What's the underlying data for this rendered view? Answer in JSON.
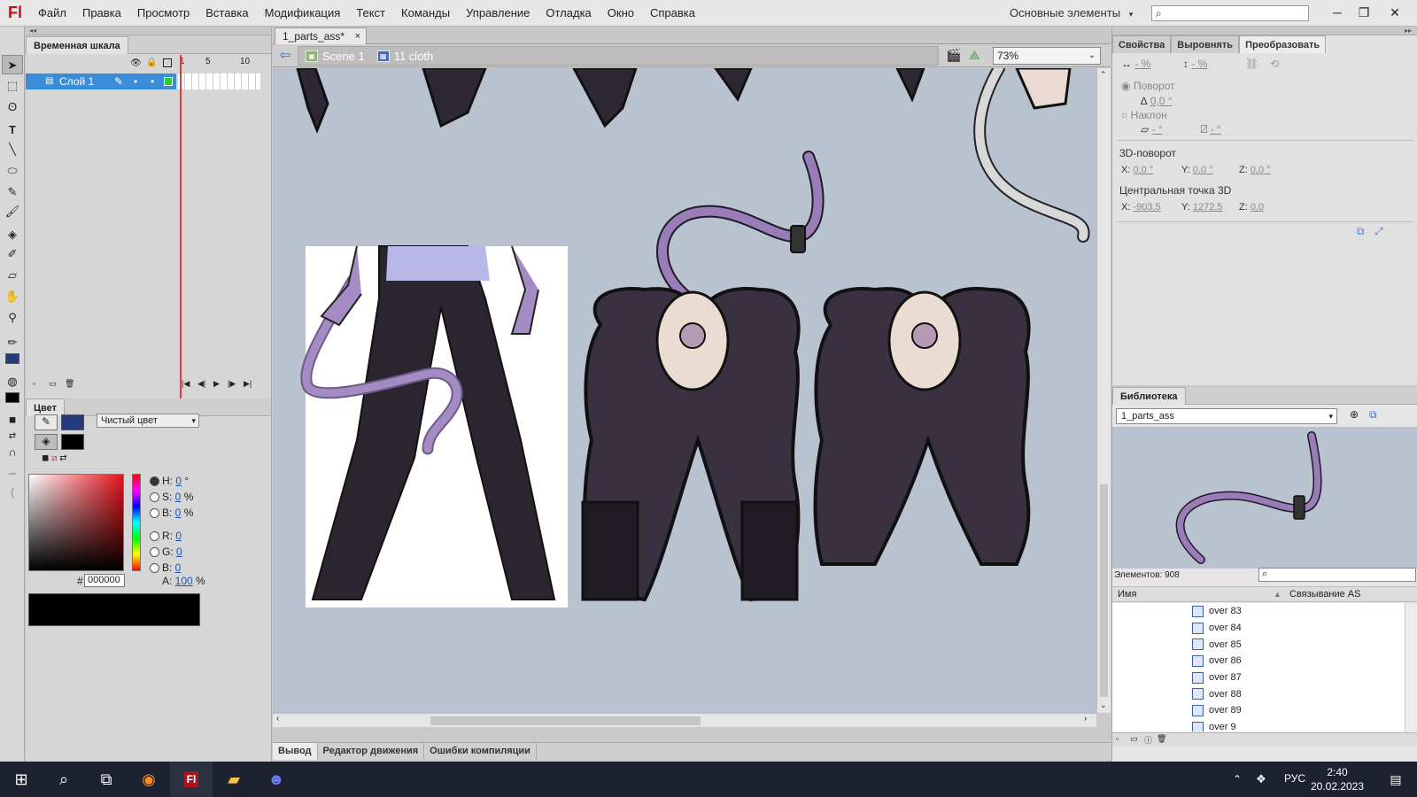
{
  "app": {
    "logo": "Fl",
    "menu": [
      "Файл",
      "Правка",
      "Просмотр",
      "Вставка",
      "Модификация",
      "Текст",
      "Команды",
      "Управление",
      "Отладка",
      "Окно",
      "Справка"
    ],
    "workspace": "Основные элементы",
    "window_controls": [
      "─",
      "❐",
      "✕"
    ]
  },
  "timeline": {
    "tab": "Временная шкала",
    "layer_name": "Слой 1",
    "frame_numbers": [
      "1",
      "5",
      "10"
    ]
  },
  "color_panel": {
    "tab": "Цвет",
    "color_type": "Чистый цвет",
    "H": "0",
    "H_unit": "°",
    "S": "0",
    "S_unit": "%",
    "B": "0",
    "B_unit": "%",
    "R": "0",
    "G": "0",
    "Bl": "0",
    "hex_prefix": "#",
    "hex": "000000",
    "alpha": "100",
    "alpha_unit": "%",
    "stroke_color": "#243a7a",
    "fill_color": "#000000"
  },
  "document": {
    "tab": "1_parts_ass*",
    "tab_close": "×",
    "breadcrumbs": [
      "Scene 1",
      "11 cloth"
    ],
    "zoom": "73%"
  },
  "properties": {
    "tabs": [
      "Свойства",
      "Выровнять",
      "Преобразовать"
    ],
    "width_pct": "- %",
    "height_pct": "- %",
    "rotate_label": "Поворот",
    "rotate_value": "0,0 °",
    "skew_label": "Наклон",
    "skew_h": "- °",
    "skew_v": "- °",
    "rotate3d_label": "3D-поворот",
    "rot3d": {
      "x_label": "X:",
      "x": "0,0 °",
      "y_label": "Y:",
      "y": "0,0 °",
      "z_label": "Z:",
      "z": "0,0 °"
    },
    "center3d_label": "Центральная точка 3D",
    "center3d": {
      "x_label": "X:",
      "x": "-903,5",
      "y_label": "Y:",
      "y": "1272,5",
      "z_label": "Z:",
      "z": "0,0"
    }
  },
  "library": {
    "tab": "Библиотека",
    "document": "1_parts_ass",
    "count": "Элементов: 908",
    "col_name": "Имя",
    "col_linkage": "Связывание AS",
    "items": [
      "over 83",
      "over 84",
      "over 85",
      "over 86",
      "over 87",
      "over 88",
      "over 89",
      "over 9"
    ]
  },
  "output_tabs": [
    "Вывод",
    "Редактор движения",
    "Ошибки компиляции"
  ],
  "taskbar": {
    "lang": "РУС",
    "time": "2:40",
    "date": "20.02.2023"
  },
  "colors": {
    "accent_selected_layer": "#3a8dd9",
    "stage_bg": "#b9c3cf",
    "taskbar": "#1e2230"
  }
}
